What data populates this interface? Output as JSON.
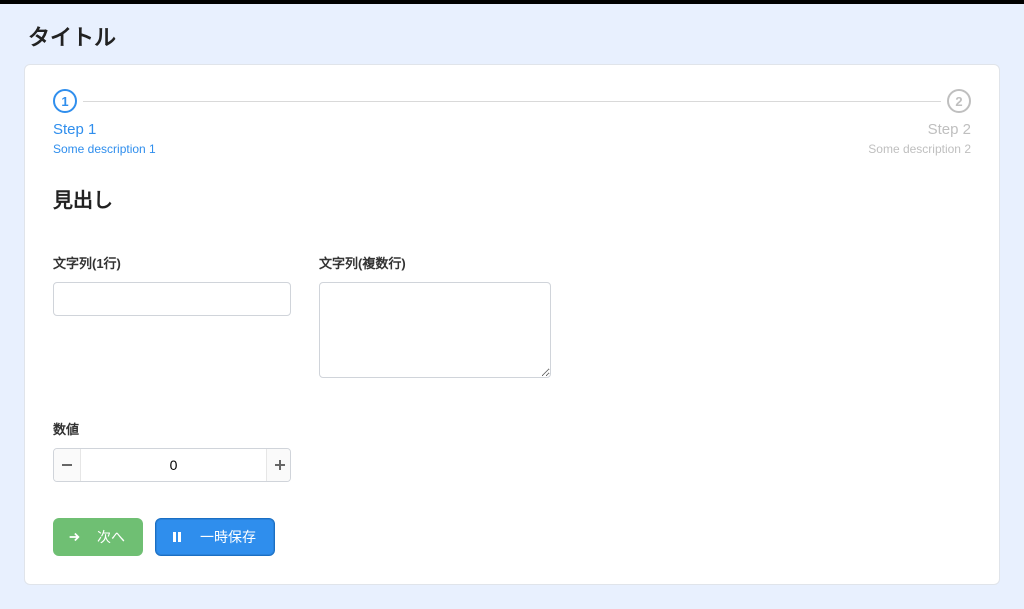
{
  "pageTitle": "タイトル",
  "steps": [
    {
      "num": "1",
      "title": "Step 1",
      "desc": "Some description 1",
      "active": true
    },
    {
      "num": "2",
      "title": "Step 2",
      "desc": "Some description 2",
      "active": false
    }
  ],
  "sectionHeading": "見出し",
  "fields": {
    "textSingle": {
      "label": "文字列(1行)",
      "value": ""
    },
    "textMulti": {
      "label": "文字列(複数行)",
      "value": ""
    },
    "number": {
      "label": "数値",
      "value": "0"
    }
  },
  "actions": {
    "next": "次へ",
    "save": "一時保存"
  }
}
